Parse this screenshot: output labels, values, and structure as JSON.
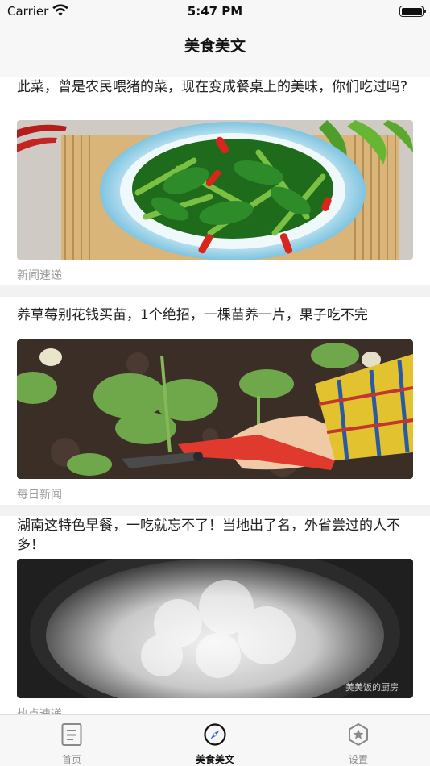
{
  "status_bar": {
    "carrier": "Carrier",
    "time": "5:47 PM"
  },
  "nav": {
    "title": "美食美文"
  },
  "articles": [
    {
      "title": "此菜，曾是农民喂猪的菜，现在变成餐桌上的美味，你们吃过吗?",
      "source": "新闻速递",
      "image": "stir-fried-greens-photo"
    },
    {
      "title": "养草莓别花钱买苗，1个绝招，一棵苗养一片，果子吃不完",
      "source": "每日新闻",
      "image": "strawberry-plant-photo"
    },
    {
      "title": "湖南这特色早餐，一吃就忘不了！当地出了名，外省尝过的人不多！",
      "source": "热点速递",
      "image": "steaming-rice-photo",
      "watermark": "美美饭的厨房"
    }
  ],
  "tab_bar": {
    "tabs": [
      {
        "label": "首页",
        "icon": "document-icon",
        "active": false
      },
      {
        "label": "美食美文",
        "icon": "compass-icon",
        "active": true
      },
      {
        "label": "设置",
        "icon": "star-badge-icon",
        "active": false
      }
    ]
  },
  "colors": {
    "active_tint": "#111111",
    "inactive_tint": "#8a8a8a",
    "bar_bg": "#f7f7f7"
  }
}
